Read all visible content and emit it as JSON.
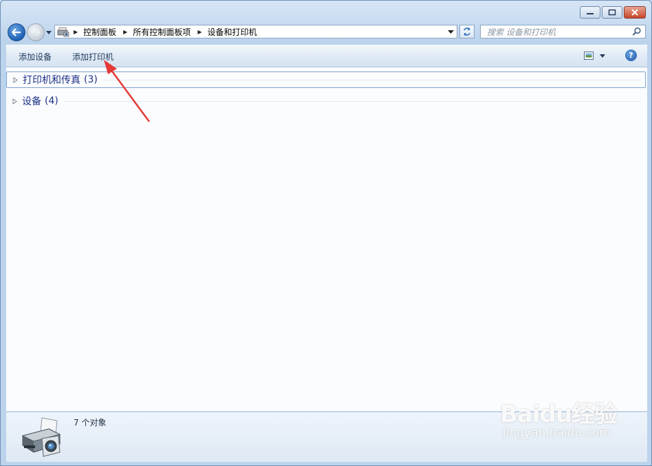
{
  "navigation": {
    "breadcrumb": [
      "控制面板",
      "所有控制面板项",
      "设备和打印机"
    ],
    "search_placeholder": "搜索 设备和打印机"
  },
  "commands": {
    "add_device": "添加设备",
    "add_printer": "添加打印机",
    "help_label": "?"
  },
  "groups": [
    {
      "label": "打印机和传真",
      "count": "(3)",
      "expanded": false
    },
    {
      "label": "设备",
      "count": "(4)",
      "expanded": false
    }
  ],
  "status": {
    "summary": "7 个对象"
  },
  "watermark": {
    "main": "Baidu经验",
    "sub": "jingyan.baidu.com"
  },
  "colors": {
    "accent": "#1e3287",
    "annotation": "#e53935"
  }
}
